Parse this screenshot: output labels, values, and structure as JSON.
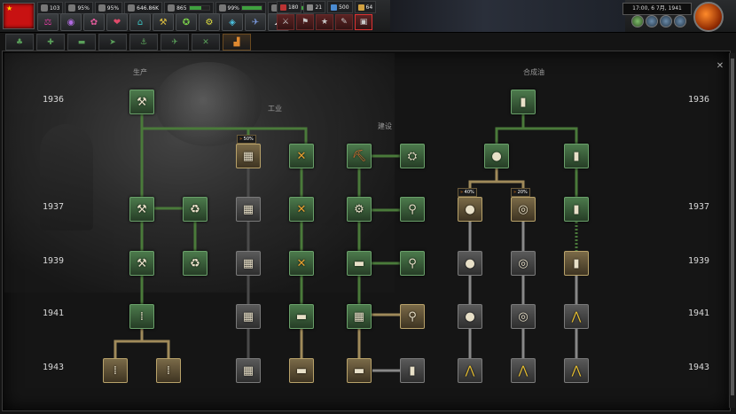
{
  "topbar": {
    "resources": [
      {
        "icon": "manpower-icon",
        "value": "103",
        "bar": 0
      },
      {
        "icon": "stability-icon",
        "value": "95%",
        "bar": 0
      },
      {
        "icon": "war-support-icon",
        "value": "95%",
        "bar": 0
      },
      {
        "icon": "manpower-pool-icon",
        "value": "646.86K",
        "bar": 0
      },
      {
        "icon": "factory-icon",
        "value": "865",
        "bar": 0.6
      },
      {
        "icon": "supply-icon",
        "value": "99%",
        "bar": 0.99
      },
      {
        "icon": "convoy-icon",
        "value": "1K",
        "bar": 0.8
      }
    ],
    "alerts": [
      {
        "icon": "division-icon",
        "value": "180"
      },
      {
        "icon": "star-icon",
        "value": "21"
      },
      {
        "icon": "army-xp-icon",
        "value": "500"
      },
      {
        "icon": "air-xp-icon",
        "value": "64"
      }
    ],
    "date": "17:00, 6 7月, 1941"
  },
  "tabs": [
    {
      "icon": "infantry-tab-icon",
      "glyph": "♣"
    },
    {
      "icon": "support-tab-icon",
      "glyph": "✚"
    },
    {
      "icon": "armor-tab-icon",
      "glyph": "▬"
    },
    {
      "icon": "artillery-tab-icon",
      "glyph": "➤"
    },
    {
      "icon": "naval-tab-icon",
      "glyph": "⚓"
    },
    {
      "icon": "air-tab-icon",
      "glyph": "✈"
    },
    {
      "icon": "engineering-tab-icon",
      "glyph": "✕"
    },
    {
      "icon": "industry-tab-icon",
      "glyph": "▟"
    }
  ],
  "categories": {
    "production": "生产",
    "industry": "工业",
    "construction": "建设",
    "synth_oil": "合成油"
  },
  "years": [
    "1936",
    "1937",
    "1939",
    "1941",
    "1943"
  ],
  "badges": [
    {
      "text": "50%"
    },
    {
      "text": "40%"
    },
    {
      "text": "20%"
    }
  ]
}
